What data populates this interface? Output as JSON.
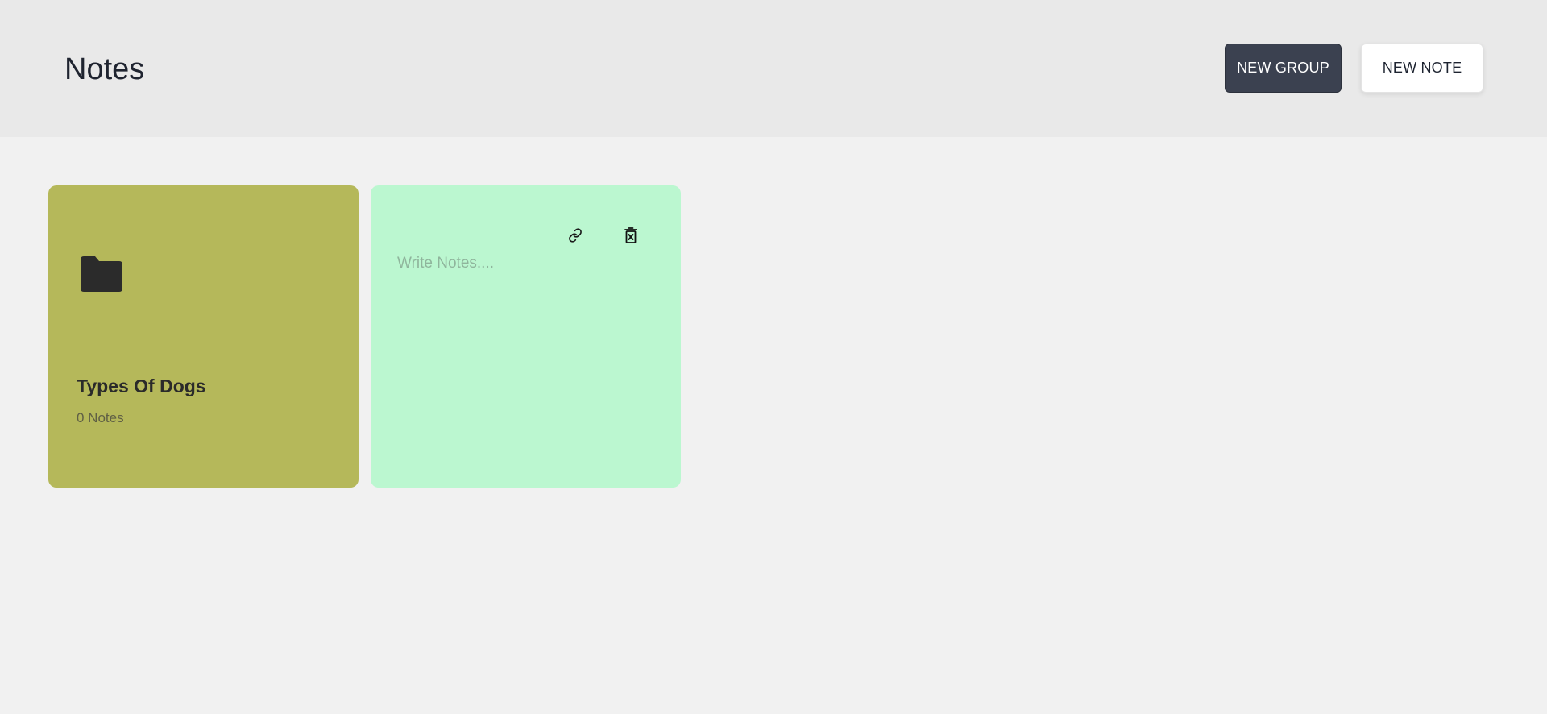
{
  "header": {
    "title": "Notes",
    "new_group_label": "NEW GROUP",
    "new_note_label": "NEW NOTE"
  },
  "groups": [
    {
      "name": "Types Of Dogs",
      "count_label": "0 Notes",
      "color": "#b5b85a",
      "icon": "folder-icon"
    }
  ],
  "notes": [
    {
      "value": "",
      "placeholder": "Write Notes....",
      "color": "#bbf7d0",
      "icons": [
        "link-icon",
        "delete-icon"
      ]
    }
  ]
}
